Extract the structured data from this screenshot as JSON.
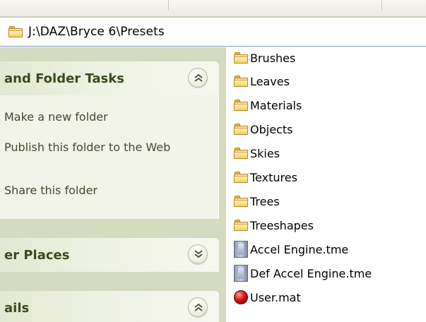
{
  "address_bar": {
    "path": "J:\\DAZ\\Bryce 6\\Presets",
    "icon": "folder-icon"
  },
  "task_pane": {
    "file_folder_tasks": {
      "title": "and Folder Tasks",
      "collapse_icon": "chevron-up-double-icon",
      "links": [
        {
          "label": "Make a new folder"
        },
        {
          "label": "Publish this folder to the Web"
        },
        {
          "label": "Share this folder"
        }
      ]
    },
    "other_places": {
      "title": "er Places",
      "collapse_icon": "chevron-down-double-icon"
    },
    "details": {
      "title": "ails",
      "collapse_icon": "chevron-up-double-icon"
    }
  },
  "files": [
    {
      "name": "Brushes",
      "icon": "folder-icon"
    },
    {
      "name": "Leaves",
      "icon": "folder-icon"
    },
    {
      "name": "Materials",
      "icon": "folder-icon"
    },
    {
      "name": "Objects",
      "icon": "folder-icon"
    },
    {
      "name": "Skies",
      "icon": "folder-icon"
    },
    {
      "name": "Textures",
      "icon": "folder-icon"
    },
    {
      "name": "Trees",
      "icon": "folder-icon"
    },
    {
      "name": "Treeshapes",
      "icon": "folder-icon"
    },
    {
      "name": "Accel Engine.tme",
      "icon": "tme-file-icon"
    },
    {
      "name": "Def Accel Engine.tme",
      "icon": "tme-file-icon"
    },
    {
      "name": "User.mat",
      "icon": "mat-file-icon"
    }
  ],
  "colors": {
    "task_pane_bg": "#d5dbc1",
    "panel_body_bg": "#f2f4e8",
    "panel_title": "#3a4a1e",
    "folder_yellow": "#f0c24f"
  }
}
